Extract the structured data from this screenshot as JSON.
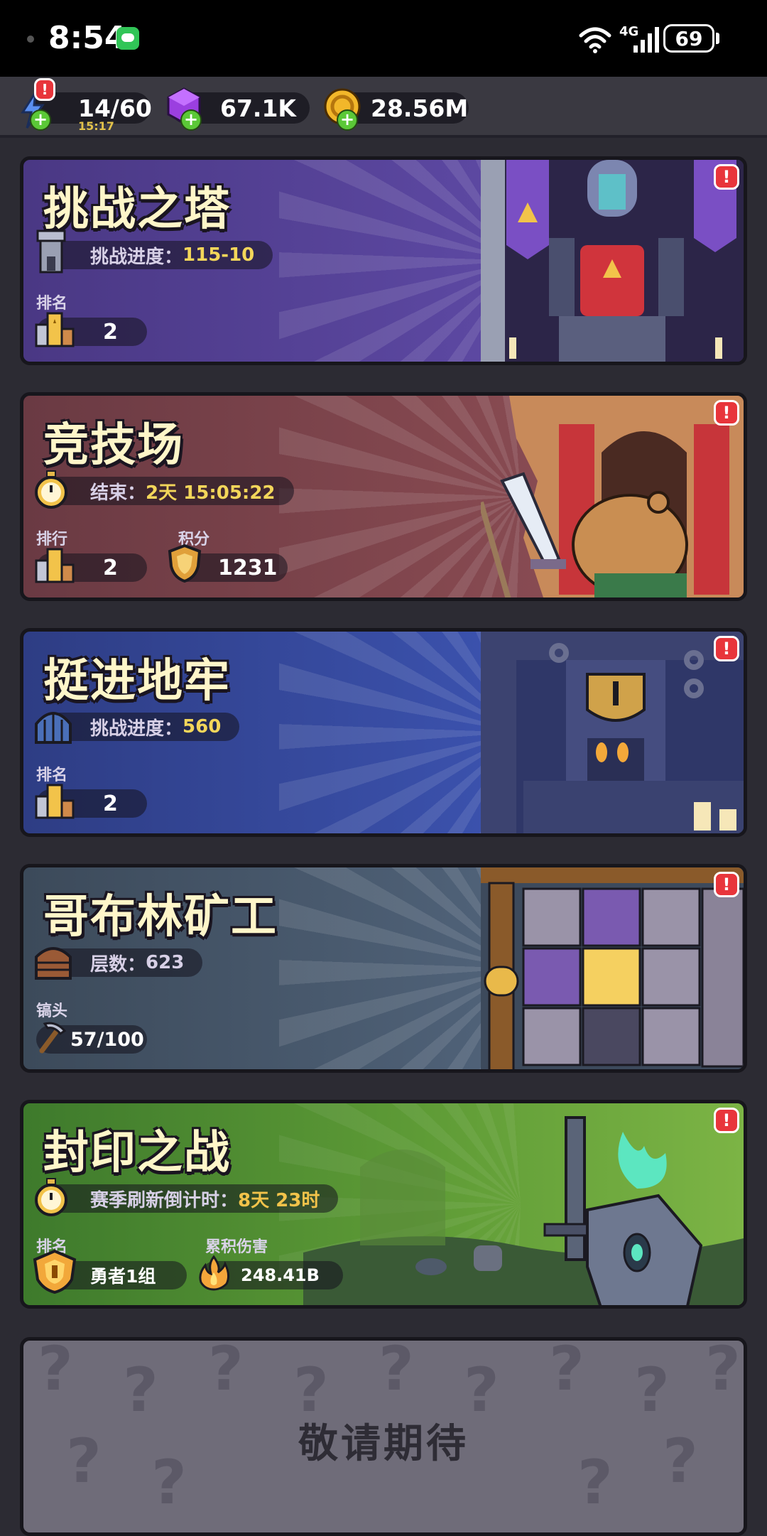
{
  "status_bar": {
    "time": "8:54",
    "network": "4G",
    "battery": "69"
  },
  "resources": {
    "energy": {
      "value": "14/60",
      "timer": "15:17"
    },
    "gems": {
      "value": "67.1K"
    },
    "coins": {
      "value": "28.56M"
    },
    "alert": "!"
  },
  "cards": [
    {
      "title": "挑战之塔",
      "progress_label": "挑战进度：",
      "progress_value": "115-10",
      "rank_label": "排名",
      "rank_value": "2",
      "alert": "!",
      "colors": {
        "bg": "#4b3a85",
        "accent": "#5d48a3"
      }
    },
    {
      "title": "竞技场",
      "end_label": "结束：",
      "end_value": "2天 15:05:22",
      "rank_label": "排行",
      "rank_value": "2",
      "points_label": "积分",
      "points_value": "1231",
      "alert": "!",
      "colors": {
        "bg": "#6b3a43",
        "accent": "#8a4c55"
      }
    },
    {
      "title": "挺进地牢",
      "progress_label": "挑战进度：",
      "progress_value": "560",
      "rank_label": "排名",
      "rank_value": "2",
      "alert": "!",
      "colors": {
        "bg": "#2f3e86",
        "accent": "#3d54b0"
      }
    },
    {
      "title": "哥布林矿工",
      "floor_label": "层数：",
      "floor_value": "623",
      "pickaxe_label": "镐头",
      "pickaxe_value": "57/100",
      "alert": "!",
      "colors": {
        "bg": "#3d4b5c",
        "accent": "#566a80"
      }
    },
    {
      "title": "封印之战",
      "season_label": "赛季刷新倒计时：",
      "season_value": "8天 23时",
      "rank_label": "排名",
      "rank_value": "勇者1组",
      "damage_label": "累积伤害",
      "damage_value": "248.41B",
      "alert": "!",
      "colors": {
        "bg": "#3f7a2c",
        "accent": "#7ab83e"
      }
    }
  ],
  "coming_soon": {
    "text": "敬请期待"
  },
  "icons": [
    "wechat-icon",
    "wifi-icon",
    "signal-icon",
    "battery-icon",
    "energy-icon",
    "gem-icon",
    "coin-icon",
    "plus-icon",
    "tower-icon",
    "podium-icon",
    "stopwatch-icon",
    "shield-icon",
    "gate-icon",
    "chest-icon",
    "pickaxe-icon",
    "rank-badge-icon",
    "fire-icon",
    "alert-icon",
    "question-mark-icon"
  ]
}
